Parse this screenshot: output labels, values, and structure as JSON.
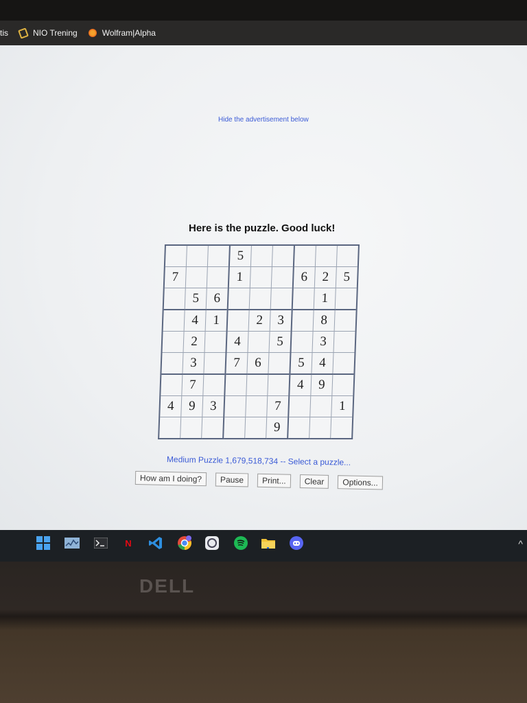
{
  "browser": {
    "bookmarks": [
      {
        "label": "tis",
        "icon": "truncated"
      },
      {
        "label": "NIO Trening",
        "icon": "nio-leaf-icon"
      },
      {
        "label": "Wolfram|Alpha",
        "icon": "wolfram-alpha-icon"
      }
    ]
  },
  "page": {
    "ad_hide_link": "Hide the advertisement below",
    "heading": "Here is the puzzle. Good luck!",
    "puzzle_info": "Medium Puzzle 1,679,518,734 -- Select a puzzle...",
    "buttons": {
      "how_am_i_doing": "How am I doing?",
      "pause": "Pause",
      "print": "Print...",
      "clear": "Clear",
      "options": "Options..."
    }
  },
  "sudoku": {
    "grid": [
      [
        "",
        "",
        "",
        "5",
        "",
        "",
        "",
        "",
        ""
      ],
      [
        "7",
        "",
        "",
        "1",
        "",
        "",
        "6",
        "2",
        "5"
      ],
      [
        "",
        "5",
        "6",
        "",
        "",
        "",
        "",
        "1",
        ""
      ],
      [
        "",
        "4",
        "1",
        "",
        "2",
        "3",
        "",
        "8",
        ""
      ],
      [
        "",
        "2",
        "",
        "4",
        "",
        "5",
        "",
        "3",
        ""
      ],
      [
        "",
        "3",
        "",
        "7",
        "6",
        "",
        "5",
        "4",
        ""
      ],
      [
        "",
        "7",
        "",
        "",
        "",
        "",
        "4",
        "9",
        ""
      ],
      [
        "4",
        "9",
        "3",
        "",
        "",
        "7",
        "",
        "",
        "1"
      ],
      [
        "",
        "",
        "",
        "",
        "",
        "9",
        "",
        "",
        ""
      ]
    ]
  },
  "taskbar": {
    "icons": [
      "windows-start-icon",
      "task-manager-icon",
      "terminal-icon",
      "netflix-icon",
      "vscode-icon",
      "chrome-icon",
      "app-icon",
      "spotify-icon",
      "file-explorer-icon",
      "discord-icon"
    ],
    "netflix_letter": "N",
    "chevron": "^"
  },
  "device": {
    "brand": "DELL"
  },
  "colors": {
    "link": "#3b5bd6",
    "grid_border": "#5a6680",
    "taskbar": "#1c2024"
  }
}
